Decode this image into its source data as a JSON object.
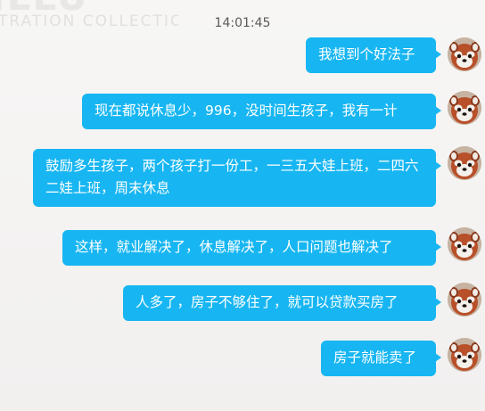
{
  "watermark": {
    "big_text": "ILLU",
    "text": "TRATION COLLECTION"
  },
  "timestamp": "14:01:45",
  "messages": [
    {
      "text": "我想到个好法子"
    },
    {
      "text": "现在都说休息少，996，没时间生孩子，我有一计"
    },
    {
      "text": "鼓励多生孩子，两个孩子打一份工，一三五大娃上班，二四六二娃上班，周末休息"
    },
    {
      "text": "这样，就业解决了，休息解决了，人口问题也解决了"
    },
    {
      "text": "人多了，房子不够住了，就可以贷款买房了"
    },
    {
      "text": "房子就能卖了"
    }
  ],
  "colors": {
    "bubble": "#17b6f2",
    "bubble_text": "#ffffff",
    "background": "#f2f1f0",
    "timestamp": "#5a5a5a"
  },
  "avatar_icon": "red-panda-avatar-icon"
}
